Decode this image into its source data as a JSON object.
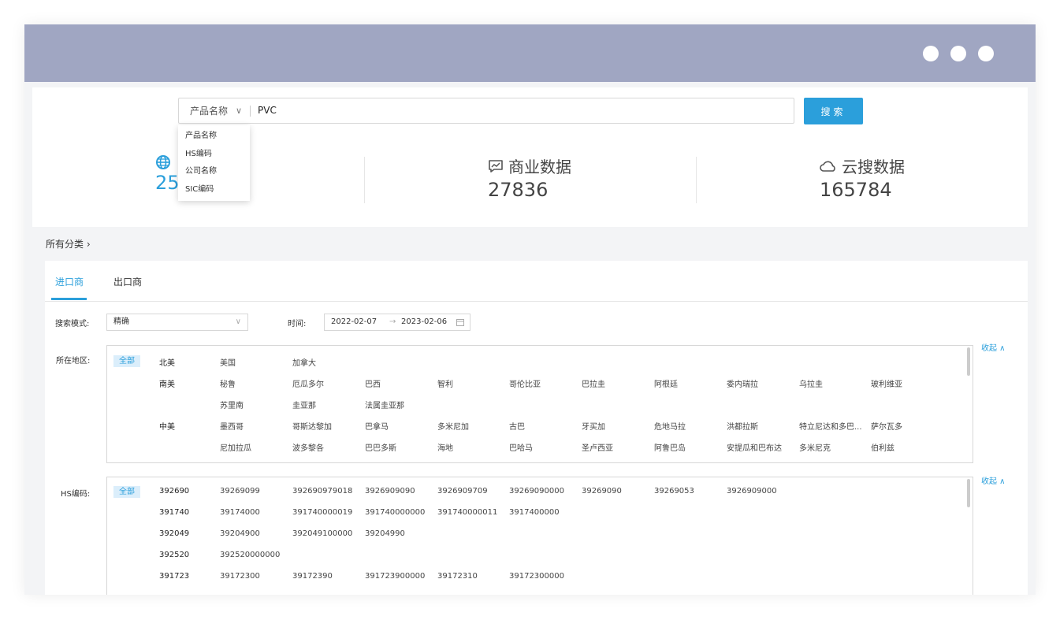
{
  "search": {
    "type_selected": "产品名称",
    "query": "PVC",
    "button_label": "搜索",
    "type_options": [
      "产品名称",
      "HS编码",
      "公司名称",
      "SIC编码"
    ]
  },
  "stats": [
    {
      "label": "",
      "value": "25",
      "icon": "globe-icon"
    },
    {
      "label": "商业数据",
      "value": "27836",
      "icon": "chat-chart-icon"
    },
    {
      "label": "云搜数据",
      "value": "165784",
      "icon": "cloud-search-icon"
    }
  ],
  "breadcrumb": {
    "label": "所有分类",
    "chevron": "›"
  },
  "tabs": [
    {
      "label": "进口商",
      "active": true
    },
    {
      "label": "出口商",
      "active": false
    }
  ],
  "filters": {
    "mode_label": "搜索模式:",
    "mode_value": "精确",
    "time_label": "时间:",
    "date_start": "2022-02-07",
    "date_arrow": "→",
    "date_end": "2023-02-06",
    "region_label": "所在地区:",
    "hs_label": "HS编码:",
    "all_label": "全部",
    "collapse_label": "收起 ∧"
  },
  "regions": [
    {
      "group": "北美",
      "items": [
        "美国",
        "加拿大"
      ]
    },
    {
      "group": "南美",
      "items": [
        "秘鲁",
        "厄瓜多尔",
        "巴西",
        "智利",
        "哥伦比亚",
        "巴拉圭",
        "阿根廷",
        "委内瑞拉",
        "乌拉圭",
        "玻利维亚"
      ]
    },
    {
      "group": "",
      "items": [
        "苏里南",
        "圭亚那",
        "法属圭亚那"
      ]
    },
    {
      "group": "中美",
      "items": [
        "墨西哥",
        "哥斯达黎加",
        "巴拿马",
        "多米尼加",
        "古巴",
        "牙买加",
        "危地马拉",
        "洪都拉斯",
        "特立尼达和多巴...",
        "萨尔瓦多"
      ]
    },
    {
      "group": "",
      "items": [
        "尼加拉瓜",
        "波多黎各",
        "巴巴多斯",
        "海地",
        "巴哈马",
        "圣卢西亚",
        "阿鲁巴岛",
        "安提瓜和巴布达",
        "多米尼克",
        "伯利兹"
      ]
    }
  ],
  "hs_codes": [
    {
      "group": "392690",
      "items": [
        "39269099",
        "392690979018",
        "3926909090",
        "3926909709",
        "39269090000",
        "39269090",
        "39269053",
        "3926909000"
      ]
    },
    {
      "group": "391740",
      "items": [
        "39174000",
        "391740000019",
        "391740000000",
        "391740000011",
        "3917400000"
      ]
    },
    {
      "group": "392049",
      "items": [
        "39204900",
        "392049100000",
        "39204990"
      ]
    },
    {
      "group": "392520",
      "items": [
        "392520000000"
      ]
    },
    {
      "group": "391723",
      "items": [
        "39172300",
        "39172390",
        "391723900000",
        "39172310",
        "39172300000"
      ]
    }
  ]
}
